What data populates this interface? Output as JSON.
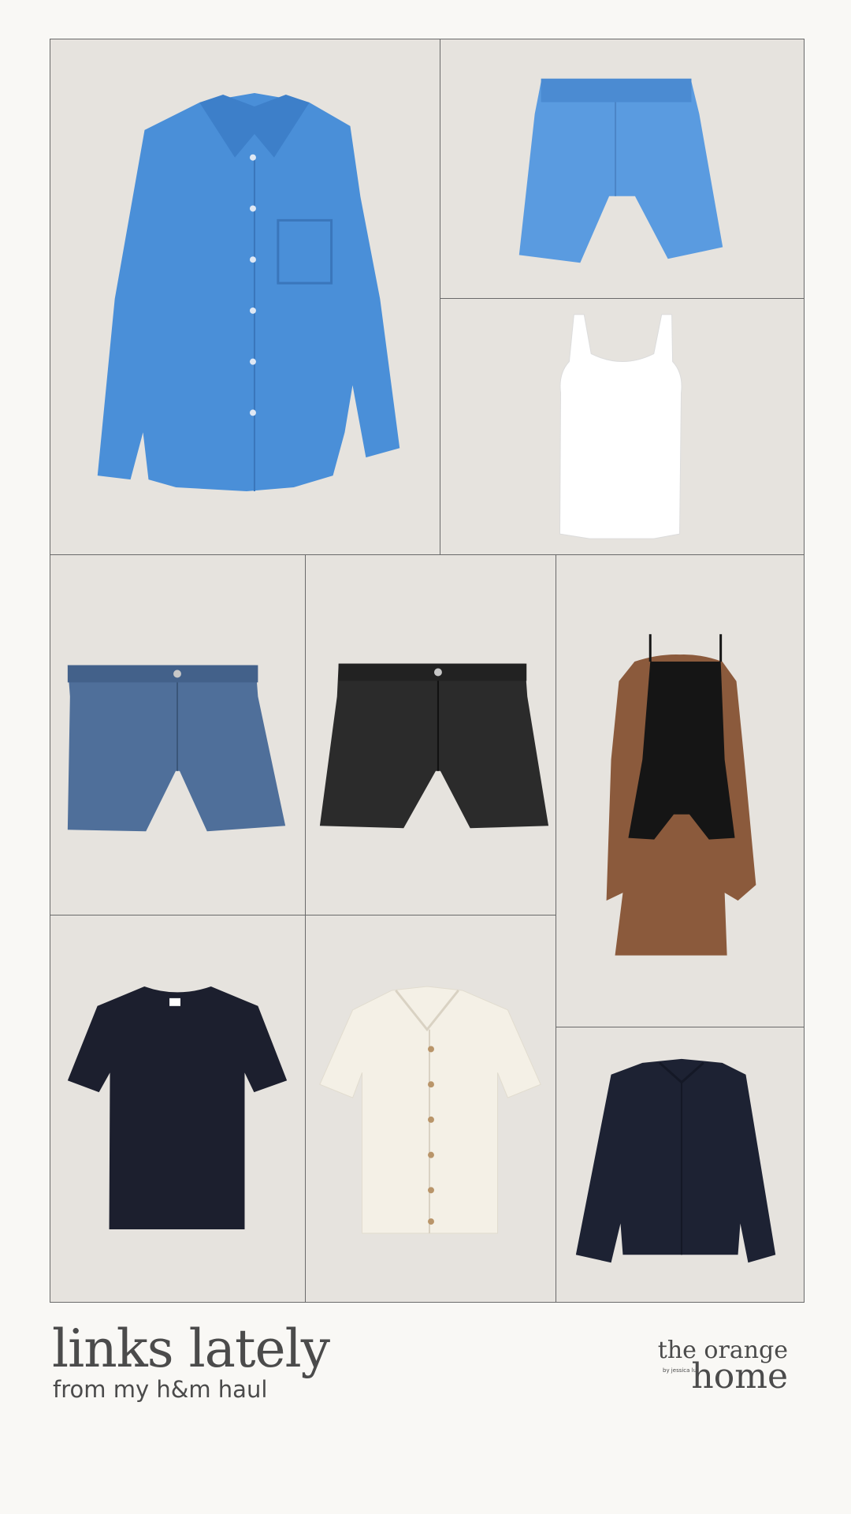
{
  "footer": {
    "title": "links lately",
    "subtitle": "from my h&m haul"
  },
  "logo": {
    "line1": "the orange",
    "line2": "home",
    "byline": "by jessica lui"
  },
  "products": [
    {
      "name": "blue linen shirt",
      "icon": "shirt-icon",
      "color": "#4a8fd8"
    },
    {
      "name": "blue linen shorts",
      "icon": "shorts-icon",
      "color": "#5a9be0"
    },
    {
      "name": "white tank top",
      "icon": "tank-icon",
      "color": "#ffffff"
    },
    {
      "name": "blue denim shorts",
      "icon": "denim-shorts-icon",
      "color": "#4f6f9a"
    },
    {
      "name": "black denim shorts",
      "icon": "denim-shorts-icon",
      "color": "#2b2b2b"
    },
    {
      "name": "black romper",
      "icon": "romper-icon",
      "color": "#151515"
    },
    {
      "name": "navy t-shirt",
      "icon": "tshirt-icon",
      "color": "#1c1f2e"
    },
    {
      "name": "cream knit shirt",
      "icon": "knit-shirt-icon",
      "color": "#f4f0e6"
    },
    {
      "name": "navy jacket",
      "icon": "jacket-icon",
      "color": "#1d2233"
    }
  ]
}
